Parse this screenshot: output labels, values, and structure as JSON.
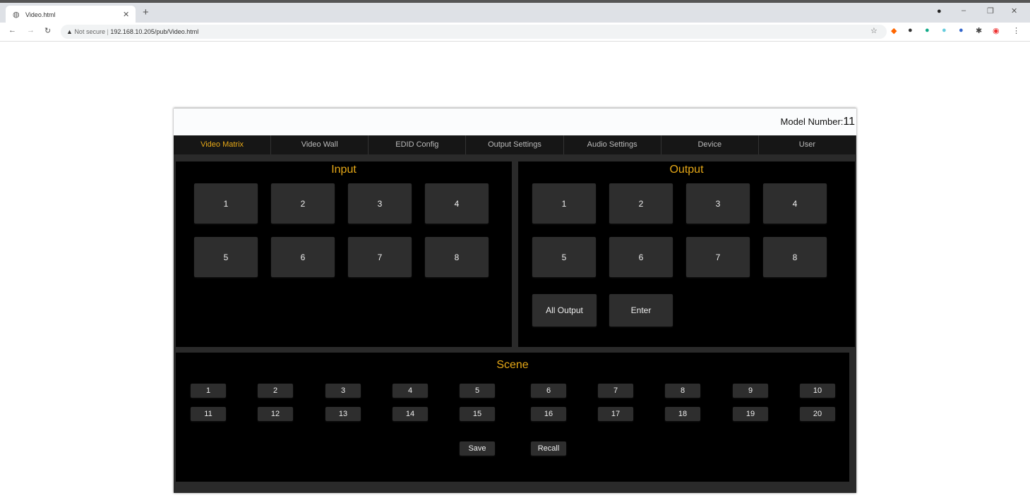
{
  "browser": {
    "tab_title": "Video.html",
    "security": "Not secure",
    "url": "192.168.10.205/pub/Video.html"
  },
  "header": {
    "model_label": "Model Number:",
    "model_value": "11"
  },
  "nav": [
    "Video Matrix",
    "Video Wall",
    "EDID Config",
    "Output Settings",
    "Audio Settings",
    "Device",
    "User"
  ],
  "input": {
    "title": "Input",
    "buttons": [
      "1",
      "2",
      "3",
      "4",
      "5",
      "6",
      "7",
      "8"
    ]
  },
  "output": {
    "title": "Output",
    "buttons": [
      "1",
      "2",
      "3",
      "4",
      "5",
      "6",
      "7",
      "8"
    ],
    "all_output": "All Output",
    "enter": "Enter"
  },
  "scene": {
    "title": "Scene",
    "buttons": [
      "1",
      "2",
      "3",
      "4",
      "5",
      "6",
      "7",
      "8",
      "9",
      "10",
      "11",
      "12",
      "13",
      "14",
      "15",
      "16",
      "17",
      "18",
      "19",
      "20"
    ],
    "save": "Save",
    "recall": "Recall"
  },
  "colors": {
    "accent": "#e6a817"
  }
}
